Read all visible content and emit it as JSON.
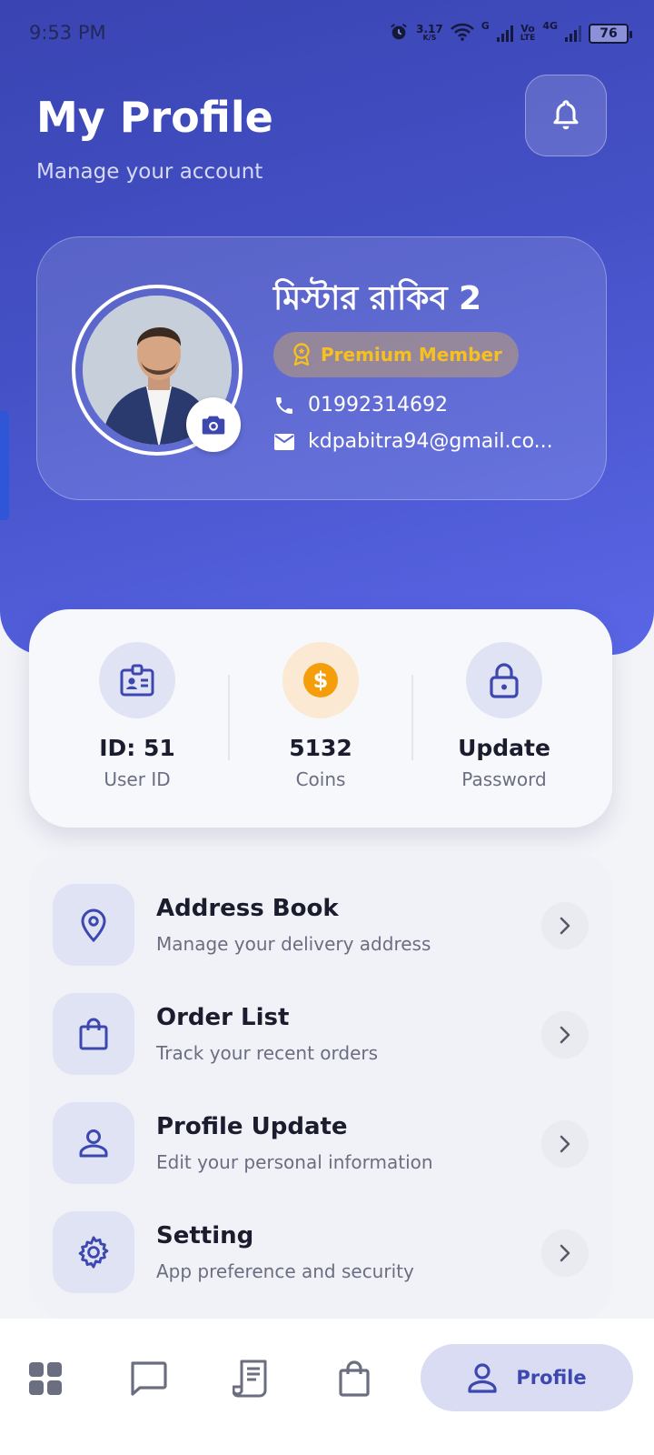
{
  "status_bar": {
    "time": "9:53 PM",
    "speed_value": "3.17",
    "speed_unit": "K/S",
    "net_g": "G",
    "volte_top": "Vo",
    "volte_bottom": "LTE",
    "net_4g": "4G",
    "battery": "76"
  },
  "header": {
    "title": "My Profile",
    "subtitle": "Manage your account"
  },
  "profile": {
    "name": "মিস্টার রাকিব 2",
    "badge": "Premium Member",
    "phone": "01992314692",
    "email": "kdpabitra94@gmail.co..."
  },
  "stats": [
    {
      "value": "ID: 51",
      "label": "User ID",
      "icon": "id-badge-icon"
    },
    {
      "value": "5132",
      "label": "Coins",
      "icon": "dollar-coin-icon"
    },
    {
      "value": "Update",
      "label": "Password",
      "icon": "lock-icon"
    }
  ],
  "menu": [
    {
      "title": "Address Book",
      "subtitle": "Manage your delivery address",
      "icon": "location-pin-icon"
    },
    {
      "title": "Order List",
      "subtitle": "Track your recent orders",
      "icon": "shopping-bag-icon"
    },
    {
      "title": "Profile Update",
      "subtitle": "Edit your personal information",
      "icon": "person-icon"
    },
    {
      "title": "Setting",
      "subtitle": "App preference and security",
      "icon": "gear-icon"
    }
  ],
  "bottom_nav": {
    "items": [
      "grid-icon",
      "chat-icon",
      "receipt-icon",
      "bag-icon",
      "person-icon"
    ],
    "active_label": "Profile"
  },
  "colors": {
    "primary": "#4451c6",
    "accent_gold": "#f7c021",
    "coin_orange": "#f59e0b",
    "icon_blue": "#3c48b0"
  }
}
